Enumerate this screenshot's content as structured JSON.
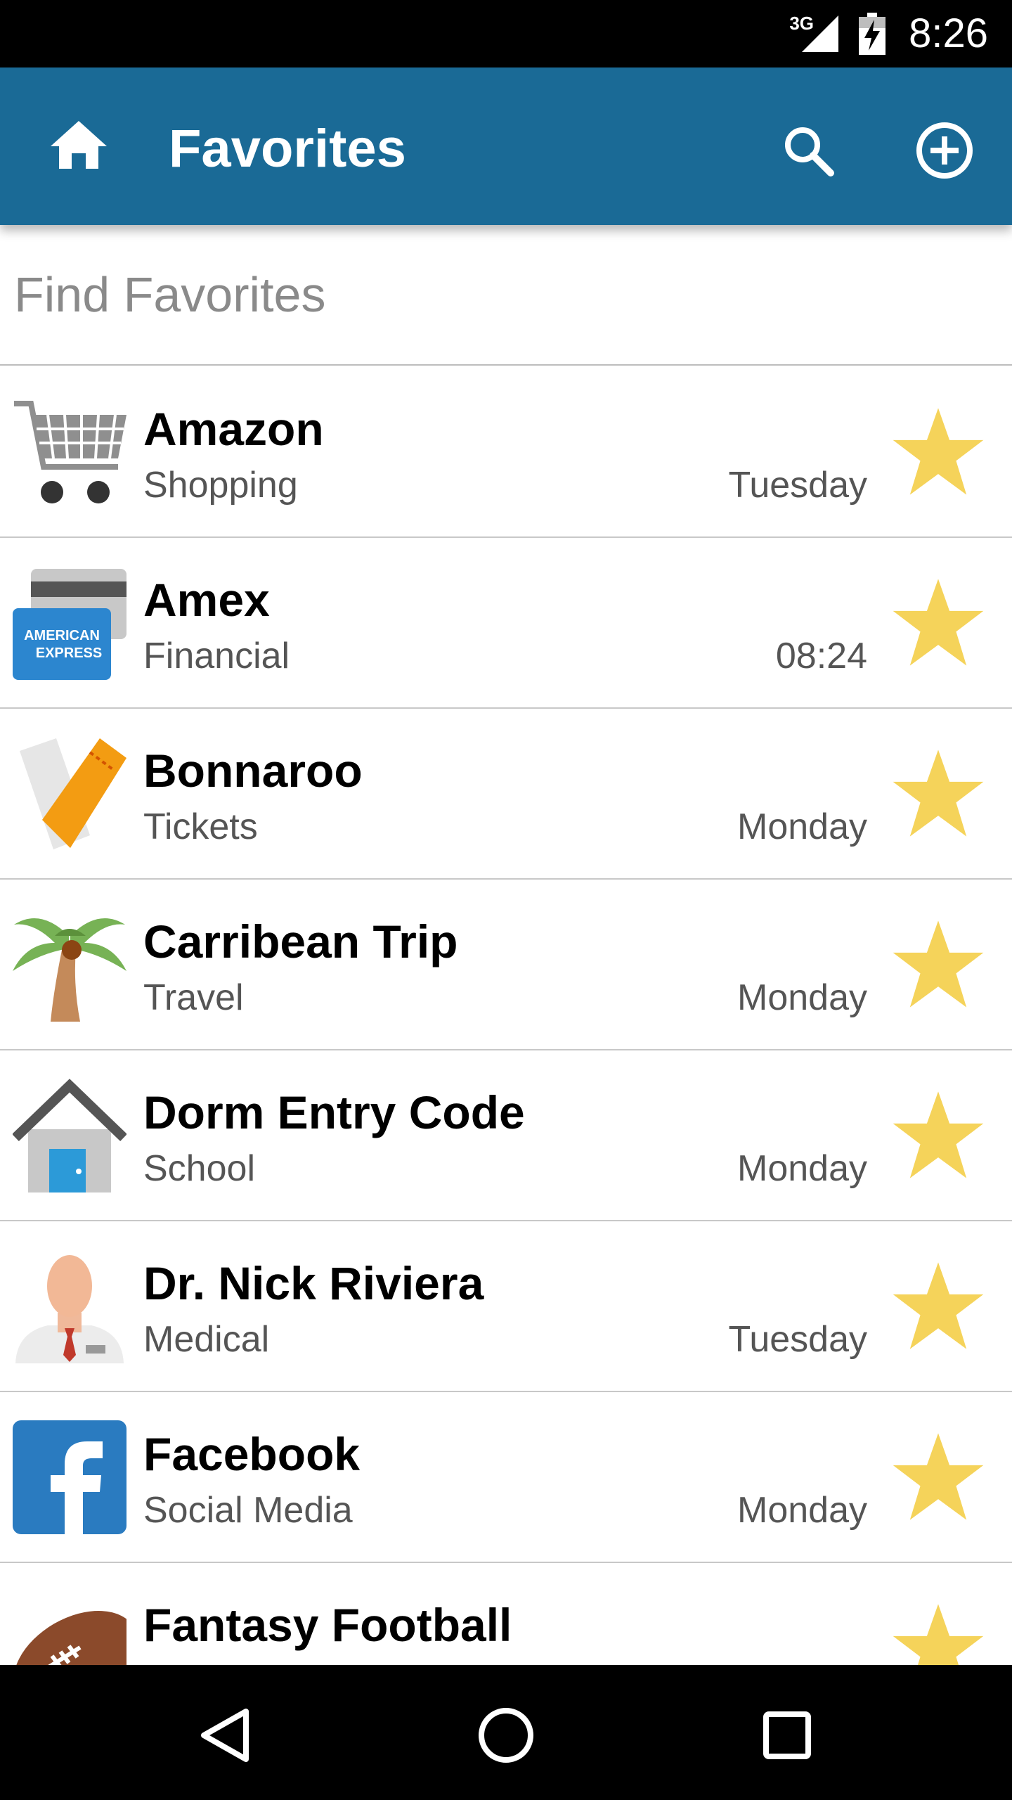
{
  "status_bar": {
    "network_label": "3G",
    "time": "8:26"
  },
  "app_bar": {
    "title": "Favorites",
    "home_icon": "home-icon",
    "search_icon": "search-icon",
    "add_icon": "add-circle-icon"
  },
  "search": {
    "placeholder": "Find Favorites"
  },
  "favorites": [
    {
      "name": "Amazon",
      "category": "Shopping",
      "date": "Tuesday",
      "icon": "shopping-cart-icon",
      "starred": true
    },
    {
      "name": "Amex",
      "category": "Financial",
      "date": "08:24",
      "icon": "credit-card-icon",
      "starred": true
    },
    {
      "name": "Bonnaroo",
      "category": "Tickets",
      "date": "Monday",
      "icon": "ticket-icon",
      "starred": true
    },
    {
      "name": "Carribean Trip",
      "category": "Travel",
      "date": "Monday",
      "icon": "palm-tree-icon",
      "starred": true
    },
    {
      "name": "Dorm Entry Code",
      "category": "School",
      "date": "Monday",
      "icon": "house-icon",
      "starred": true
    },
    {
      "name": "Dr. Nick Riviera",
      "category": "Medical",
      "date": "Tuesday",
      "icon": "doctor-icon",
      "starred": true
    },
    {
      "name": "Facebook",
      "category": "Social Media",
      "date": "Monday",
      "icon": "facebook-icon",
      "starred": true
    },
    {
      "name": "Fantasy Football",
      "category": "",
      "date": "",
      "icon": "football-icon",
      "starred": true
    }
  ],
  "colors": {
    "app_bar": "#1A6A96",
    "star": "#F5D35A",
    "divider": "#C8C8C8"
  },
  "nav_bar": {
    "back_icon": "back-icon",
    "home_icon": "home-circle-icon",
    "recents_icon": "recents-icon"
  }
}
